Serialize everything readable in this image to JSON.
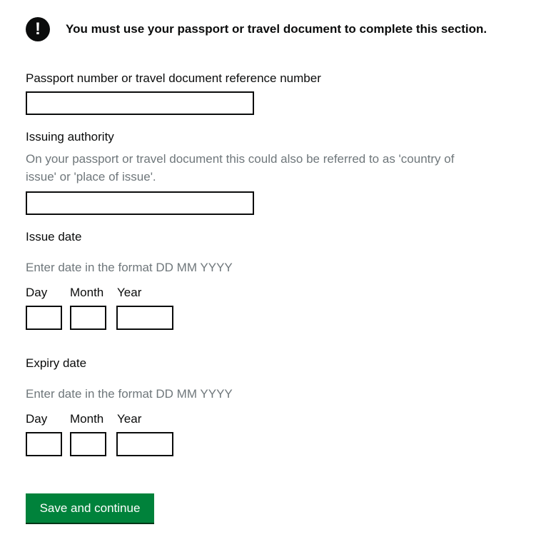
{
  "warning": {
    "icon": "exclamation-icon",
    "icon_glyph": "!",
    "text": "You must use your passport or travel document to complete this section."
  },
  "passport_number": {
    "label": "Passport number or travel document reference number",
    "value": ""
  },
  "issuing_authority": {
    "label": "Issuing authority",
    "hint_line1": "On your passport or travel document this could also be referred to as 'country of",
    "hint_line2": "issue' or 'place of issue'.",
    "value": ""
  },
  "issue_date": {
    "legend": "Issue date",
    "hint": "Enter date in the format DD MM YYYY",
    "day_label": "Day",
    "month_label": "Month",
    "year_label": "Year",
    "day_value": "",
    "month_value": "",
    "year_value": ""
  },
  "expiry_date": {
    "legend": "Expiry date",
    "hint": "Enter date in the format DD MM YYYY",
    "day_label": "Day",
    "month_label": "Month",
    "year_label": "Year",
    "day_value": "",
    "month_value": "",
    "year_value": ""
  },
  "submit": {
    "label": "Save and continue"
  },
  "colors": {
    "text": "#0b0c0c",
    "hint": "#6f777b",
    "button": "#00823b"
  }
}
